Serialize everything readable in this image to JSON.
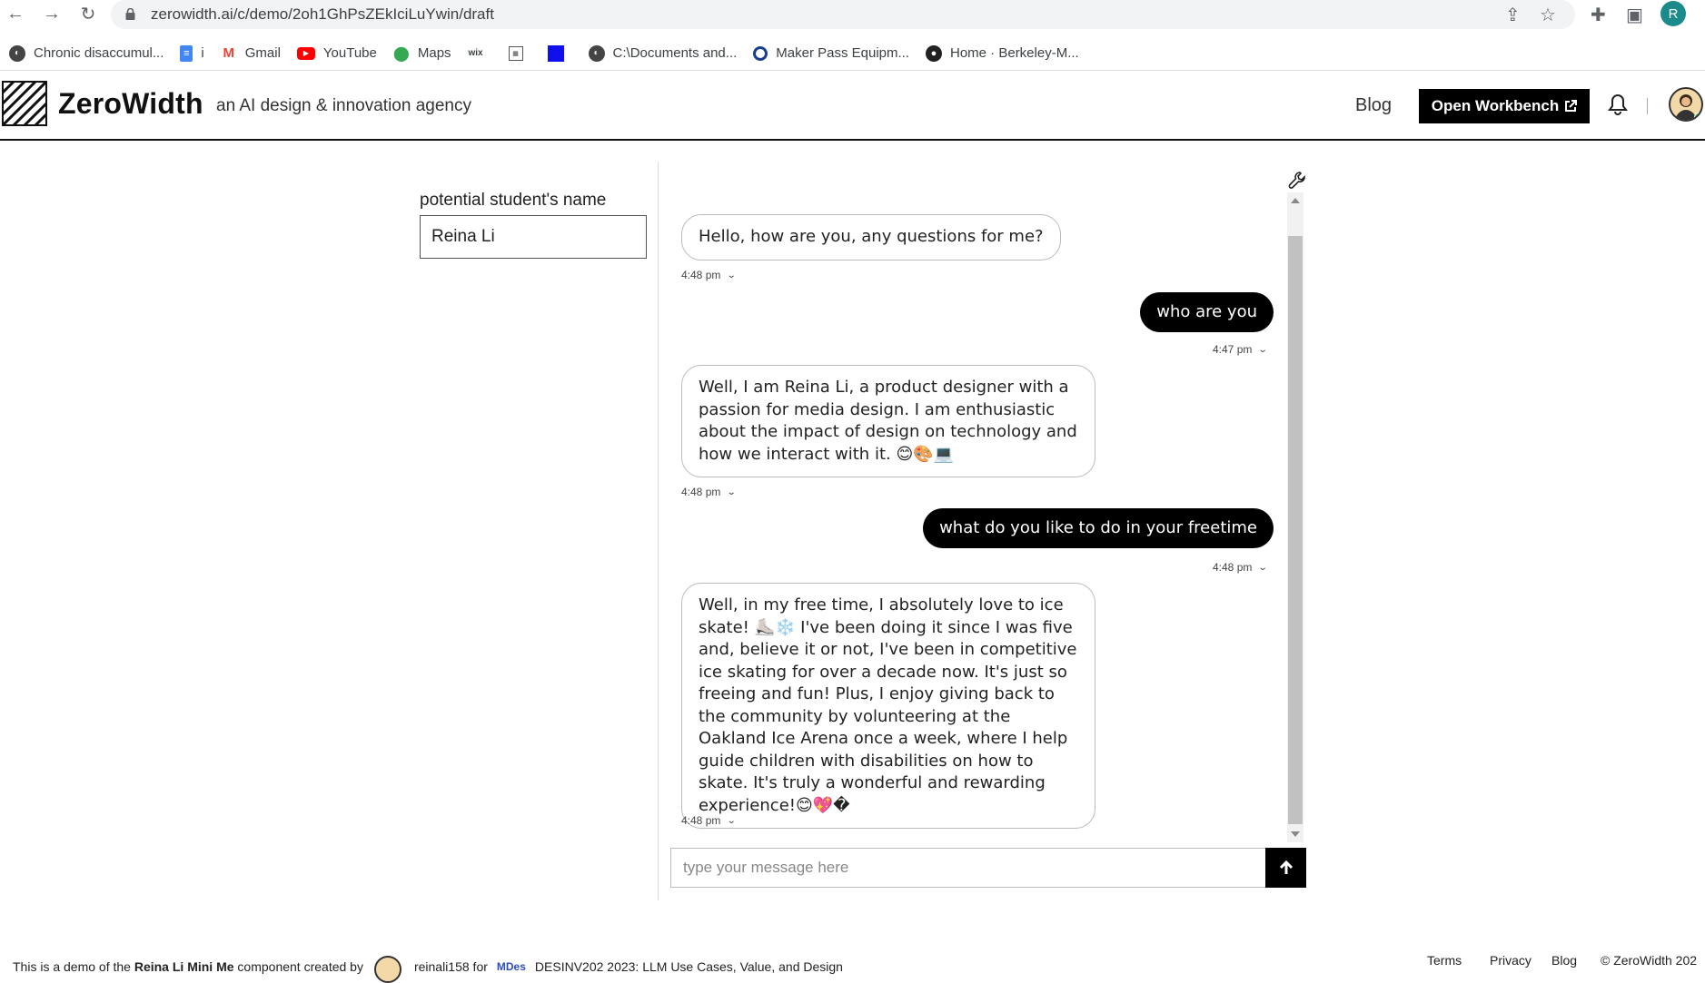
{
  "browser": {
    "url": "zerowidth.ai/c/demo/2oh1GhPsZEkIciLuYwin/draft",
    "profile_initial": "R",
    "bookmarks": [
      {
        "label": "Chronic disaccumul...",
        "icon": "globe-icon"
      },
      {
        "label": "i",
        "icon": "docs-icon"
      },
      {
        "label": "Gmail",
        "icon": "gmail-icon"
      },
      {
        "label": "YouTube",
        "icon": "youtube-icon"
      },
      {
        "label": "Maps",
        "icon": "maps-icon"
      },
      {
        "label": "",
        "icon": "wix-icon"
      },
      {
        "label": "",
        "icon": "dora-icon"
      },
      {
        "label": "",
        "icon": "blue-square-icon"
      },
      {
        "label": "C:\\Documents and...",
        "icon": "globe-icon"
      },
      {
        "label": "Maker Pass Equipm...",
        "icon": "maker-icon"
      },
      {
        "label": "Home · Berkeley-M...",
        "icon": "github-icon"
      }
    ]
  },
  "header": {
    "brand": "ZeroWidth",
    "tagline": "an AI design & innovation agency",
    "blog": "Blog",
    "open_workbench": "Open Workbench"
  },
  "form": {
    "label": "potential student's name",
    "value": "Reina Li"
  },
  "chat": {
    "messages": [
      {
        "role": "assistant",
        "text": "Hello, how are you, any questions for me?",
        "time": "4:48 pm"
      },
      {
        "role": "user",
        "text": "who are you",
        "time": "4:47 pm"
      },
      {
        "role": "assistant",
        "text": "Well, I am Reina Li, a product designer with a passion for media design. I am enthusiastic about the impact of design on technology and how we interact with it. 😊🎨💻",
        "time": "4:48 pm"
      },
      {
        "role": "user",
        "text": "what do you like to do in your freetime",
        "time": "4:48 pm"
      },
      {
        "role": "assistant",
        "text": "Well, in my free time, I absolutely love to ice skate! ⛸️❄️ I've been doing it since I was five and, believe it or not, I've been in competitive ice skating for over a decade now. It's just so freeing and fun! Plus, I enjoy giving back to the community by volunteering at the Oakland Ice Arena once a week, where I help guide children with disabilities on how to skate. It's truly a wonderful and rewarding experience!😊💖�",
        "time": "4:48 pm"
      }
    ],
    "input_placeholder": "type your message here"
  },
  "footer": {
    "prefix": "This is a demo of the",
    "component": "Reina Li Mini Me",
    "middle": "component created by",
    "creator": "reinali158 for",
    "org": "MDes",
    "course": "DESINV202 2023: LLM Use Cases, Value, and Design",
    "terms": "Terms",
    "privacy": "Privacy",
    "blog": "Blog",
    "copyright": "© ZeroWidth 202"
  }
}
